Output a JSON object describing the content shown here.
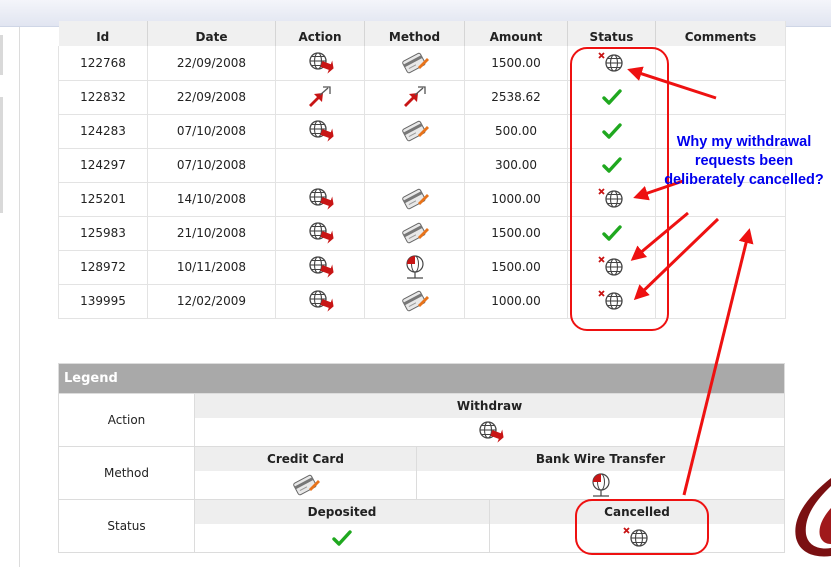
{
  "table": {
    "headers": [
      "Id",
      "Date",
      "Action",
      "Method",
      "Amount",
      "Status",
      "Comments"
    ],
    "rows": [
      {
        "id": "122768",
        "date": "22/09/2008",
        "action": "withdraw",
        "method": "credit-card",
        "amount": "1500.00",
        "status": "cancelled",
        "comments": ""
      },
      {
        "id": "122832",
        "date": "22/09/2008",
        "action": "transfer",
        "method": "transfer",
        "amount": "2538.62",
        "status": "deposited",
        "comments": ""
      },
      {
        "id": "124283",
        "date": "07/10/2008",
        "action": "withdraw",
        "method": "credit-card",
        "amount": "500.00",
        "status": "deposited",
        "comments": ""
      },
      {
        "id": "124297",
        "date": "07/10/2008",
        "action": "",
        "method": "",
        "amount": "300.00",
        "status": "deposited",
        "comments": ""
      },
      {
        "id": "125201",
        "date": "14/10/2008",
        "action": "withdraw",
        "method": "credit-card",
        "amount": "1000.00",
        "status": "cancelled",
        "comments": ""
      },
      {
        "id": "125983",
        "date": "21/10/2008",
        "action": "withdraw",
        "method": "credit-card",
        "amount": "1500.00",
        "status": "deposited",
        "comments": ""
      },
      {
        "id": "128972",
        "date": "10/11/2008",
        "action": "withdraw",
        "method": "bank-wire",
        "amount": "1500.00",
        "status": "cancelled",
        "comments": ""
      },
      {
        "id": "139995",
        "date": "12/02/2009",
        "action": "withdraw",
        "method": "credit-card",
        "amount": "1000.00",
        "status": "cancelled",
        "comments": ""
      }
    ]
  },
  "legend": {
    "title": "Legend",
    "action_label": "Action",
    "withdraw_label": "Withdraw",
    "method_label": "Method",
    "credit_card_label": "Credit Card",
    "bank_wire_label": "Bank Wire Transfer",
    "status_label": "Status",
    "deposited_label": "Deposited",
    "cancelled_label": "Cancelled"
  },
  "annotation": {
    "text": "Why my withdrawal requests been deliberately cancelled?",
    "color": "#0000ee",
    "arrow_color": "#ee1111"
  }
}
